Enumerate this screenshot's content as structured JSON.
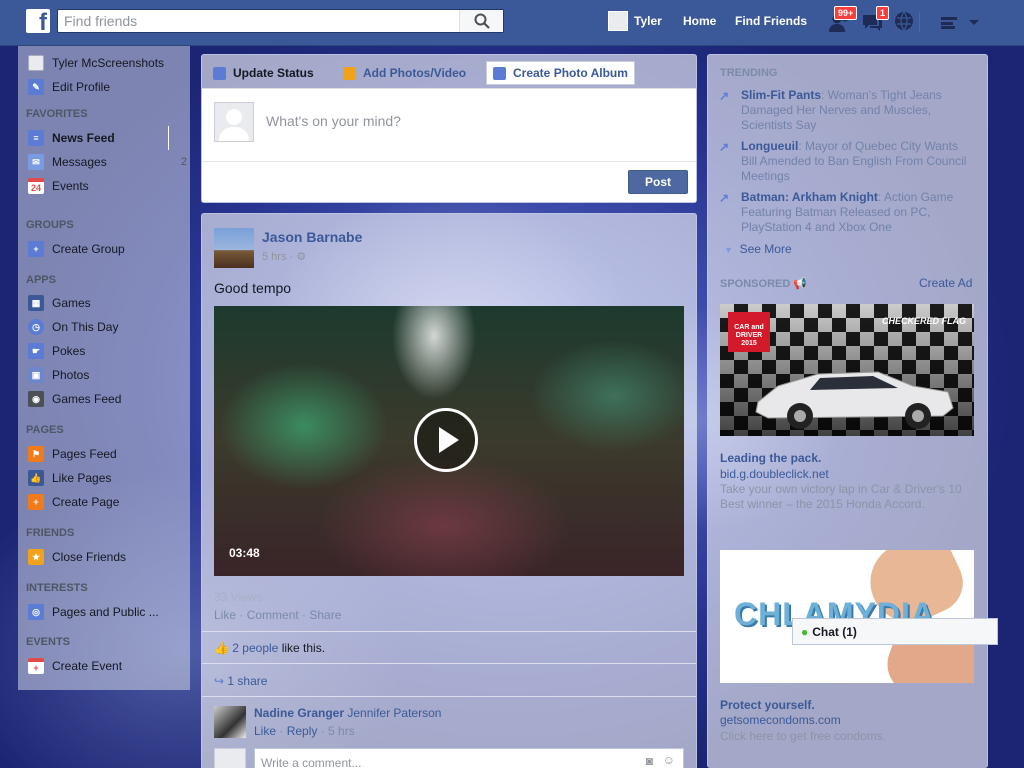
{
  "topbar": {
    "logo": "f",
    "search_placeholder": "Find friends",
    "user_name": "Tyler",
    "home": "Home",
    "find_friends": "Find Friends",
    "friend_badge": "99+",
    "message_badge": "1"
  },
  "leftnav": {
    "user": "Tyler McScreenshots",
    "edit_profile": "Edit Profile",
    "favorites_head": "FAVORITES",
    "favorites": [
      {
        "label": "News Feed",
        "color": "#5b7bd5"
      },
      {
        "label": "Messages",
        "count": "2",
        "color": "#7b9be0"
      },
      {
        "label": "Events",
        "icon_text": "24",
        "color": "#e34a4a"
      }
    ],
    "groups_head": "GROUPS",
    "groups": [
      {
        "label": "Create Group"
      }
    ],
    "apps_head": "APPS",
    "apps": [
      {
        "label": "Games"
      },
      {
        "label": "On This Day"
      },
      {
        "label": "Pokes"
      },
      {
        "label": "Photos"
      },
      {
        "label": "Games Feed"
      }
    ],
    "pages_head": "PAGES",
    "pages": [
      {
        "label": "Pages Feed"
      },
      {
        "label": "Like Pages"
      },
      {
        "label": "Create Page"
      }
    ],
    "friends_head": "FRIENDS",
    "friends": [
      {
        "label": "Close Friends"
      }
    ],
    "interests_head": "INTERESTS",
    "interests": [
      {
        "label": "Pages and Public ..."
      }
    ],
    "events_head": "EVENTS",
    "events": [
      {
        "label": "Create Event"
      }
    ]
  },
  "composer": {
    "tab_status": "Update Status",
    "tab_photos": "Add Photos/Video",
    "tab_album": "Create Photo Album",
    "placeholder": "What's on your mind?",
    "post": "Post"
  },
  "story": {
    "author": "Jason Barnabe",
    "time": "5 hrs",
    "text": "Good tempo",
    "duration": "03:48",
    "views": "33 Views",
    "like": "Like",
    "comment": "Comment",
    "share": "Share",
    "likes_link": "2 people",
    "likes_rest": "like this.",
    "shares": "1 share",
    "comment_author": "Nadine Granger",
    "comment_text": "Jennifer Paterson",
    "comment_like": "Like",
    "comment_reply": "Reply",
    "comment_time": "5 hrs",
    "write_comment": "Write a comment..."
  },
  "rightcol": {
    "trending_head": "TRENDING",
    "trends": [
      {
        "title": "Slim-Fit Pants",
        "text": ": Woman's Tight Jeans Damaged Her Nerves and Muscles, Scientists Say"
      },
      {
        "title": "Longueuil",
        "text": ": Mayor of Quebec City Wants Bill Amended to Ban English From Council Meetings"
      },
      {
        "title": "Batman: Arkham Knight",
        "text": ": Action Game Featuring Batman Released on PC, PlayStation 4 and Xbox One"
      }
    ],
    "see_more": "See More",
    "sponsored": "SPONSORED",
    "create_ad": "Create Ad",
    "ad1": {
      "banner": "CHECKERED FLAG",
      "magazine": "CAR and DRIVER 2015",
      "title": "Leading the pack.",
      "domain": "bid.g.doubleclick.net",
      "text": "Take your own victory lap in Car & Driver's 10 Best winner – the 2015 Honda Accord."
    },
    "ad2": {
      "word": "CHLAMYDIA",
      "title": "Protect yourself.",
      "domain": "getsomecondoms.com",
      "text": "Click here to get free condoms."
    },
    "chat": "Chat (1)"
  }
}
